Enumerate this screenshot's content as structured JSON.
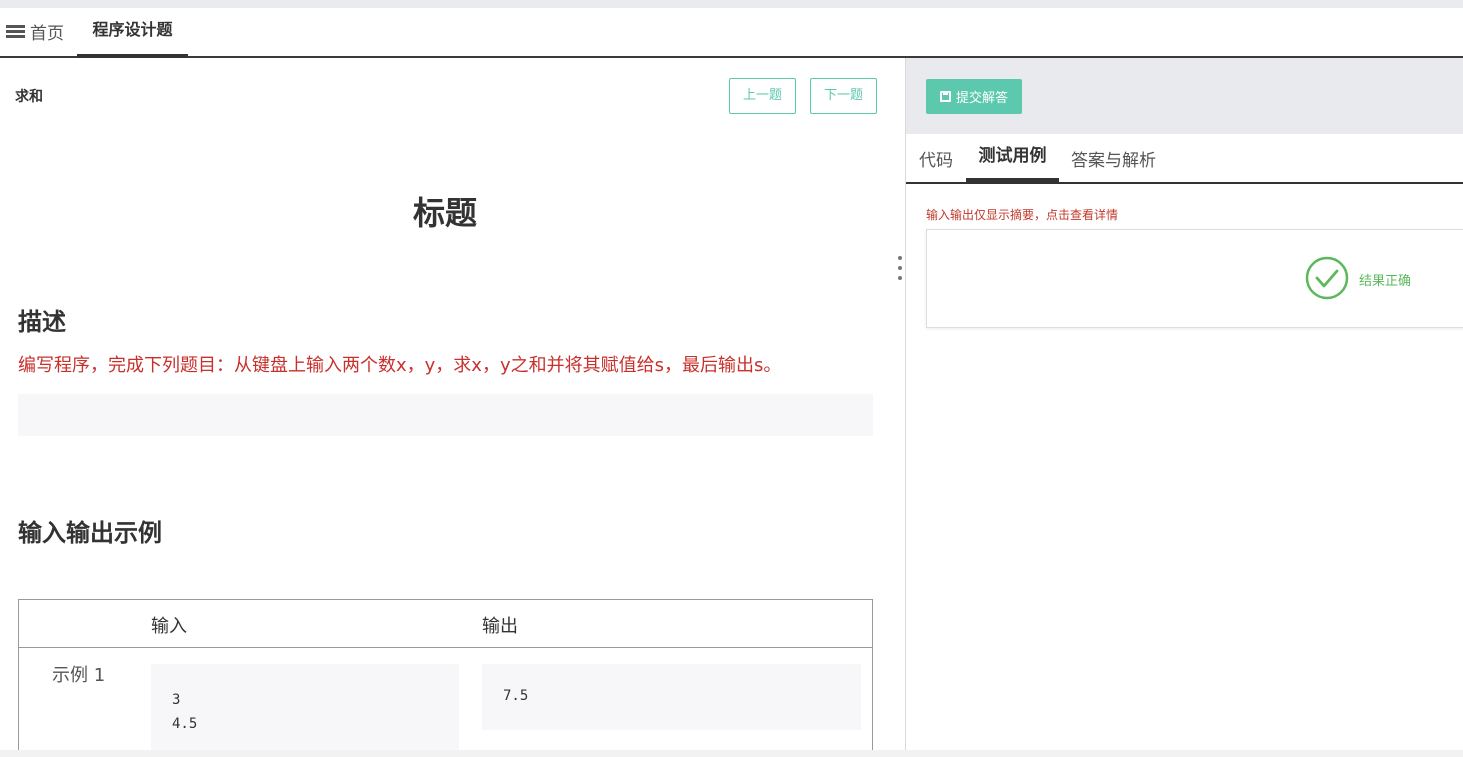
{
  "tabs": {
    "home_label": "首页",
    "active_label": "程序设计题"
  },
  "question": {
    "name": "求和",
    "prev_label": "上一题",
    "next_label": "下一题",
    "title": "标题",
    "desc_heading": "描述",
    "description": "编写程序，完成下列题目：从键盘上输入两个数x，y，求x，y之和并将其赋值给s，最后输出s。",
    "io_heading": "输入输出示例",
    "io_table": {
      "col_input": "输入",
      "col_output": "输出",
      "rows": [
        {
          "label": "示例 1",
          "input_lines": [
            "3",
            "4.5"
          ],
          "output": "7.5"
        }
      ]
    }
  },
  "right_panel": {
    "submit_label": "提交解答",
    "tabs": [
      "代码",
      "测试用例",
      "答案与解析"
    ],
    "active_tab": "测试用例",
    "hint": "输入输出仅显示摘要，点击查看详情",
    "result_text": "结果正确"
  },
  "colors": {
    "accent": "#5cc8ae",
    "description_red": "#c9302c",
    "success": "#5cb85c"
  },
  "icons": {
    "home_tab": "menu-icon",
    "submit": "save-icon",
    "result": "check-circle-icon"
  }
}
